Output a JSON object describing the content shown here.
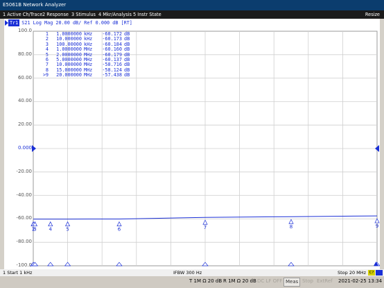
{
  "window": {
    "title": "E5061B Network Analyzer"
  },
  "menu": {
    "items": [
      "1 Active Ch/Trace",
      "2 Response",
      "3 Stimulus",
      "4 Mkr/Analysis",
      "5 Instr State"
    ],
    "resize_label": "Resize"
  },
  "trace": {
    "badge": "Tr1",
    "header": "S21 Log Mag 20.00 dB/ Ref 0.000 dB [RT]",
    "color": "#1a2fd6"
  },
  "markers": [
    {
      "num": "1",
      "stim": "1.0000000",
      "unit": "kHz",
      "value": "-60.172",
      "db": "dB"
    },
    {
      "num": "2",
      "stim": "10.000000",
      "unit": "kHz",
      "value": "-60.173",
      "db": "dB"
    },
    {
      "num": "3",
      "stim": "100.00000",
      "unit": "kHz",
      "value": "-60.184",
      "db": "dB"
    },
    {
      "num": "4",
      "stim": "1.0000000",
      "unit": "MHz",
      "value": "-60.160",
      "db": "dB"
    },
    {
      "num": "5",
      "stim": "2.0000000",
      "unit": "MHz",
      "value": "-60.179",
      "db": "dB"
    },
    {
      "num": "6",
      "stim": "5.0000000",
      "unit": "MHz",
      "value": "-60.137",
      "db": "dB"
    },
    {
      "num": "7",
      "stim": "10.000000",
      "unit": "MHz",
      "value": "-58.716",
      "db": "dB"
    },
    {
      "num": "8",
      "stim": "15.000000",
      "unit": "MHz",
      "value": "-58.124",
      "db": "dB"
    },
    {
      "num": ">9",
      "stim": "20.000000",
      "unit": "MHz",
      "value": "-57.438",
      "db": "dB"
    }
  ],
  "chart_data": {
    "type": "line",
    "title": "S21 Log Mag 20.00 dB/ Ref 0.000 dB [RT]",
    "xlabel": "",
    "ylabel": "",
    "ylim": [
      -100,
      100
    ],
    "xlim_mhz": [
      0.001,
      20
    ],
    "grid": true,
    "yticks": [
      "100.0",
      "80.00",
      "60.00",
      "40.00",
      "20.00",
      "0.000",
      "-20.00",
      "-40.00",
      "-60.00",
      "-80.00",
      "-100.0"
    ],
    "ref_value": "0.000",
    "series": [
      {
        "x": [
          0.001,
          0.01,
          0.1,
          1,
          2,
          5,
          10,
          15,
          20
        ],
        "values": [
          -60.172,
          -60.173,
          -60.184,
          -60.16,
          -60.179,
          -60.137,
          -58.716,
          -58.124,
          -57.438
        ]
      }
    ],
    "marker_labels": [
      "1",
      "2",
      "3",
      "4",
      "5",
      "6",
      "7",
      "8",
      "9"
    ]
  },
  "status": {
    "start": "1  Start 1 kHz",
    "ifbw": "IFBW 300 Hz",
    "stop": "Stop 20 MHz",
    "channel_button": "C?"
  },
  "bottom": {
    "t_port": "T 1M Ω 20 dB",
    "r_port": "R 1M Ω 20 dB",
    "dc": "DC LF OFF",
    "meas": "Meas",
    "stop": "Stop",
    "extref": "ExtRef",
    "datetime": "2021-02-25 13:34"
  }
}
